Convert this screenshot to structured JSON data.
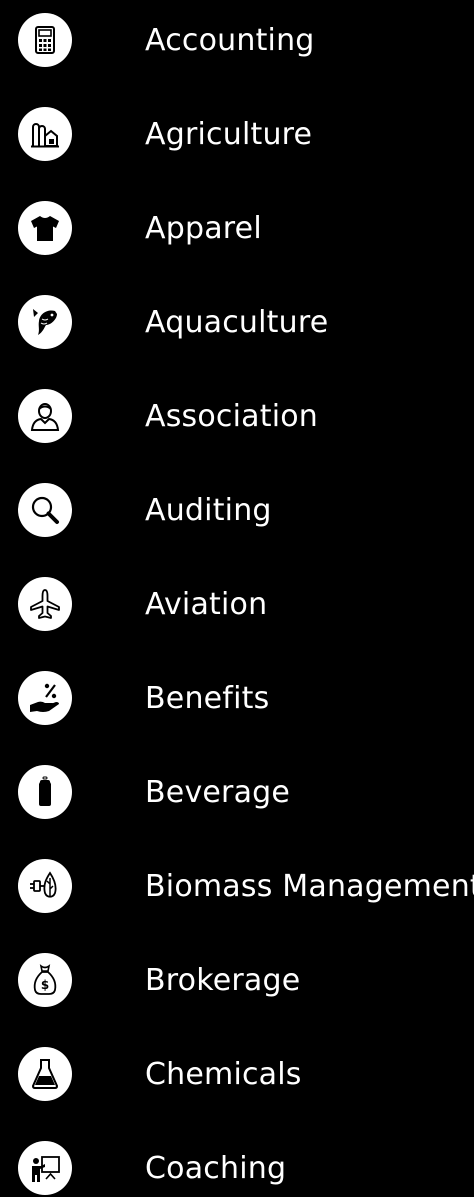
{
  "colors": {
    "background": "#000000",
    "icon_circle": "#ffffff",
    "icon_glyph": "#000000",
    "text": "#ffffff"
  },
  "industries": [
    {
      "label": "Accounting",
      "icon": "calculator-icon"
    },
    {
      "label": "Agriculture",
      "icon": "farm-buildings-icon"
    },
    {
      "label": "Apparel",
      "icon": "t-shirt-icon"
    },
    {
      "label": "Aquaculture",
      "icon": "fish-icon"
    },
    {
      "label": "Association",
      "icon": "person-icon"
    },
    {
      "label": "Auditing",
      "icon": "magnifying-glass-icon"
    },
    {
      "label": "Aviation",
      "icon": "airplane-icon"
    },
    {
      "label": "Benefits",
      "icon": "hand-percent-icon"
    },
    {
      "label": "Beverage",
      "icon": "soda-can-icon"
    },
    {
      "label": "Biomass Management",
      "icon": "plug-leaf-icon"
    },
    {
      "label": "Brokerage",
      "icon": "money-bag-icon"
    },
    {
      "label": "Chemicals",
      "icon": "flask-icon"
    },
    {
      "label": "Coaching",
      "icon": "presenter-board-icon"
    }
  ]
}
